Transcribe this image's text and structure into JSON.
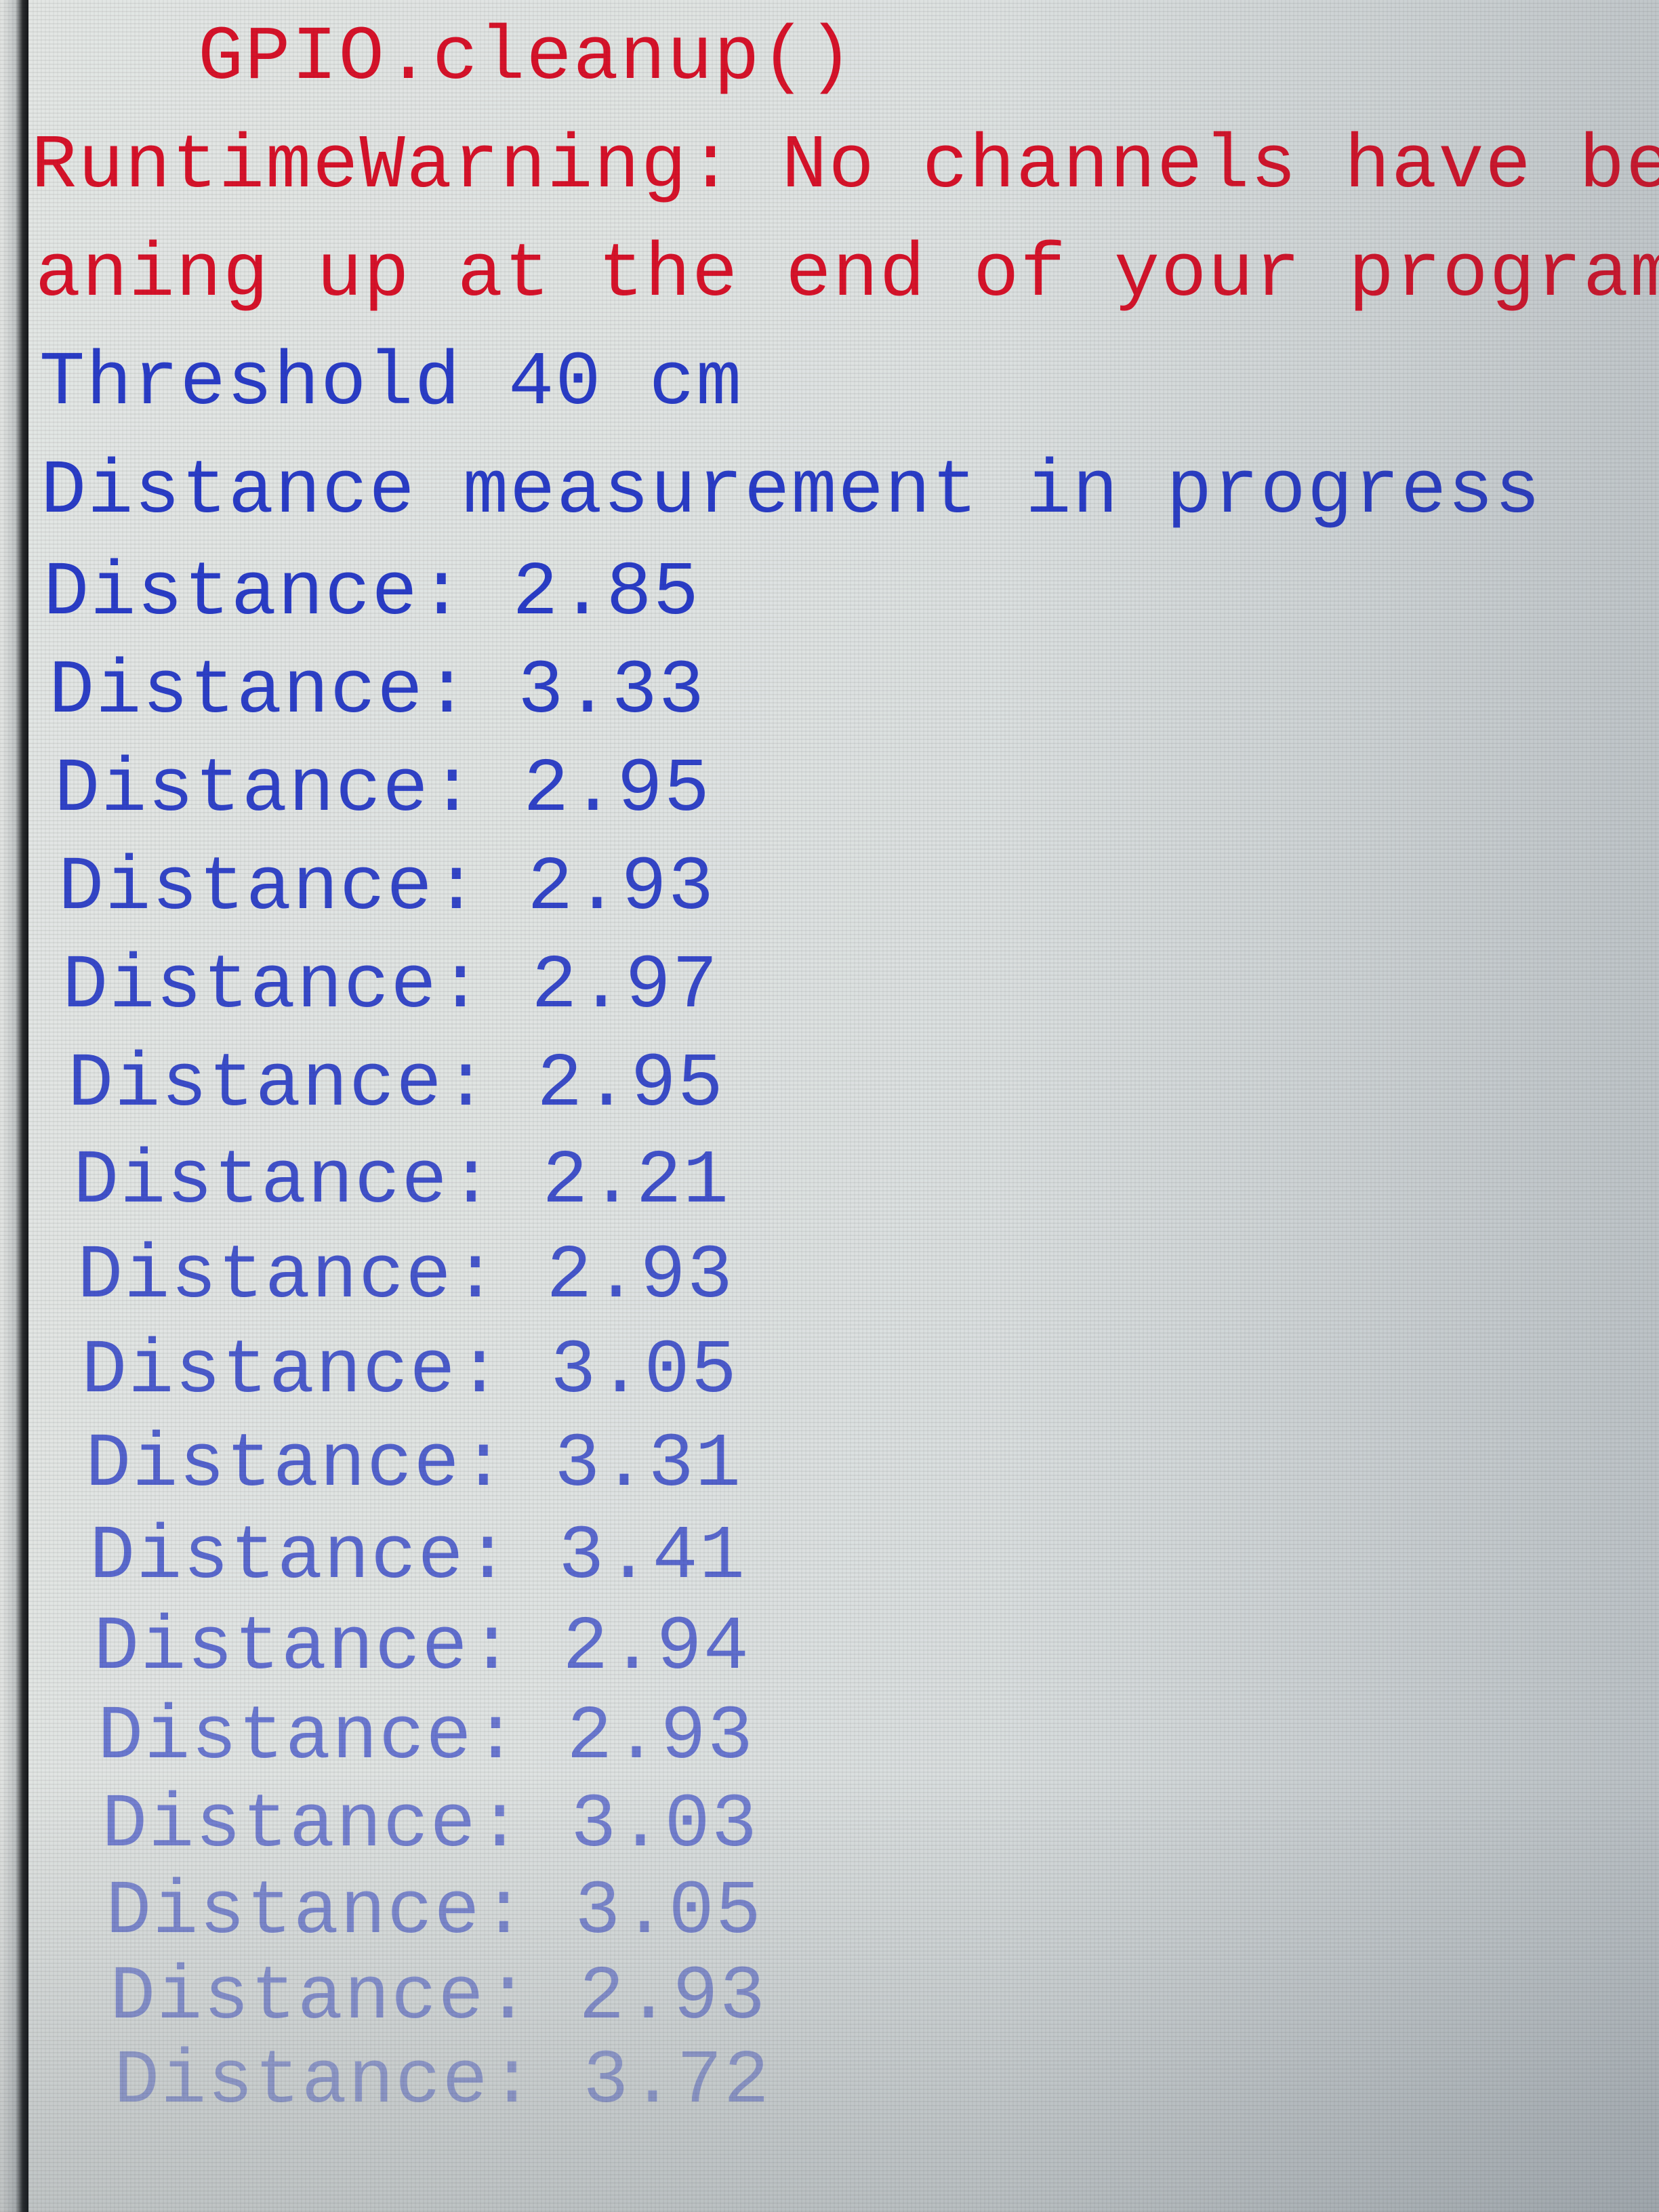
{
  "console": {
    "cleanup_call": "GPIO.cleanup()",
    "warning_line_1": "RuntimeWarning: No channels have been",
    "warning_line_2": "aning up at the end of your program in",
    "threshold": "Threshold 40 cm",
    "status": "Distance measurement in progress",
    "readings": [
      "Distance: 2.85",
      "Distance: 3.33",
      "Distance: 2.95",
      "Distance: 2.93",
      "Distance: 2.97",
      "Distance: 2.95",
      "Distance: 2.21",
      "Distance: 2.93",
      "Distance: 3.05",
      "Distance: 3.31",
      "Distance: 3.41",
      "Distance: 2.94",
      "Distance: 2.93",
      "Distance: 3.03",
      "Distance: 3.05",
      "Distance: 2.93",
      "Distance: 3.72"
    ]
  },
  "colors": {
    "error_text": "#d8132a",
    "output_text": "#2a3dc8",
    "background": "#e3e6e4"
  }
}
